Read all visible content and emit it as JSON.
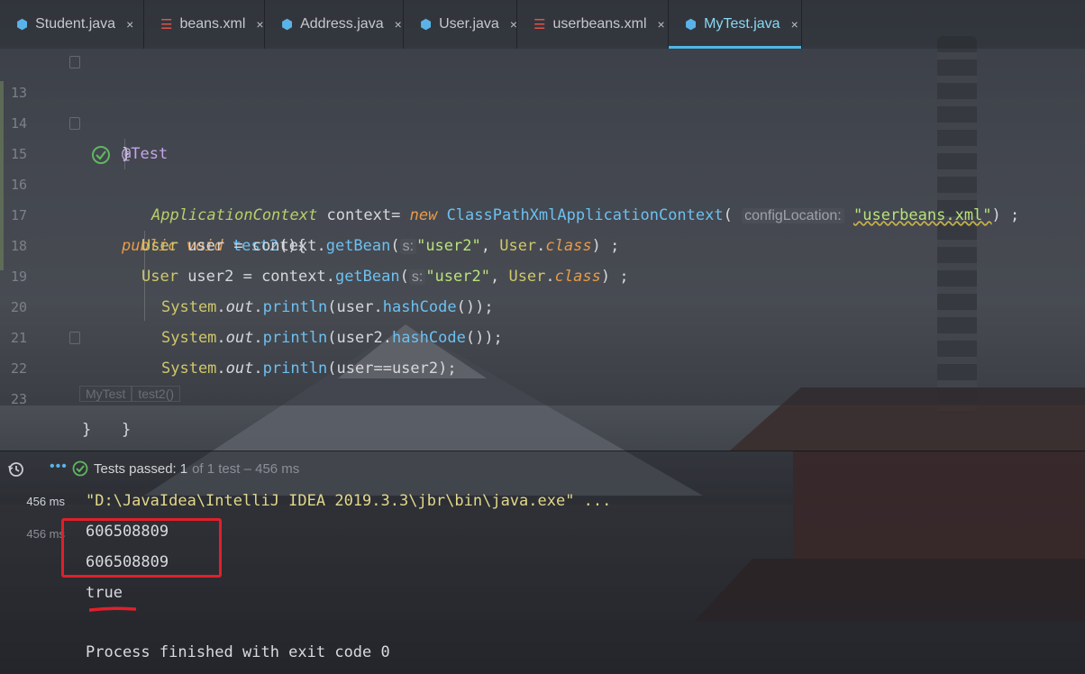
{
  "tabs": [
    {
      "label": "Student.java",
      "icon": "java-class-icon",
      "active": false
    },
    {
      "label": "beans.xml",
      "icon": "xml-file-icon",
      "active": false
    },
    {
      "label": "Address.java",
      "icon": "java-class-icon",
      "active": false
    },
    {
      "label": "User.java",
      "icon": "java-class-icon",
      "active": false
    },
    {
      "label": "userbeans.xml",
      "icon": "xml-file-icon",
      "active": false
    },
    {
      "label": "MyTest.java",
      "icon": "java-test-class-icon",
      "active": true
    }
  ],
  "tab_close_glyph": "×",
  "editor": {
    "line_numbers": [
      "13",
      "14",
      "15",
      "16",
      "17",
      "18",
      "19",
      "20",
      "21",
      "22",
      "23"
    ],
    "line13": "}",
    "line14": "@Test",
    "line15": {
      "kw1": "public",
      "kw2": "void",
      "fn": "test2",
      "rest": "(){"
    },
    "line16": {
      "type": "ApplicationContext",
      "var": " context= ",
      "new": "new",
      "ctor": "ClassPathXmlApplicationContext",
      "paren": "(",
      "hint": "configLocation:",
      "str": "\"userbeans.xml\"",
      "end": ") ;"
    },
    "line17": {
      "type": "User",
      "var": " user = context.",
      "fn": "getBean",
      "paren": "(",
      "hint": "s:",
      "str": "\"user2\"",
      "mid": ", ",
      "cls": "User",
      "dot": ".",
      "kw": "class",
      "end": ") ;"
    },
    "line18": {
      "type": "User",
      "var": " user2 = context.",
      "fn": "getBean",
      "paren": "(",
      "hint": "s:",
      "str": "\"user2\"",
      "mid": ", ",
      "cls": "User",
      "dot": ".",
      "kw": "class",
      "end": ") ;"
    },
    "line19": {
      "sys": "System",
      "dot": ".",
      "out": "out",
      "dot2": ".",
      "fn": "println",
      "args": "(user.",
      "fn2": "hashCode",
      "end": "());"
    },
    "line20": {
      "sys": "System",
      "dot": ".",
      "out": "out",
      "dot2": ".",
      "fn": "println",
      "args": "(user2.",
      "fn2": "hashCode",
      "end": "());"
    },
    "line21": {
      "sys": "System",
      "dot": ".",
      "out": "out",
      "dot2": ".",
      "fn": "println",
      "args": "(user==user2);"
    },
    "line22": "}",
    "line23": "}",
    "breadcrumb": [
      "MyTest",
      "test2()"
    ]
  },
  "run": {
    "tests_passed_label": "Tests passed:",
    "tests_passed_count": "1",
    "tests_total": "of 1 test – 456 ms",
    "time_total": "456 ms",
    "time_test": "456 ms",
    "output_lines": [
      "\"D:\\JavaIdea\\IntelliJ IDEA 2019.3.3\\jbr\\bin\\java.exe\" ...",
      "606508809",
      "606508809",
      "true",
      "",
      "Process finished with exit code 0"
    ]
  },
  "colors": {
    "accent": "#4fb8e6",
    "annotation_red": "#e0202a",
    "pass_green": "#5fb760"
  }
}
